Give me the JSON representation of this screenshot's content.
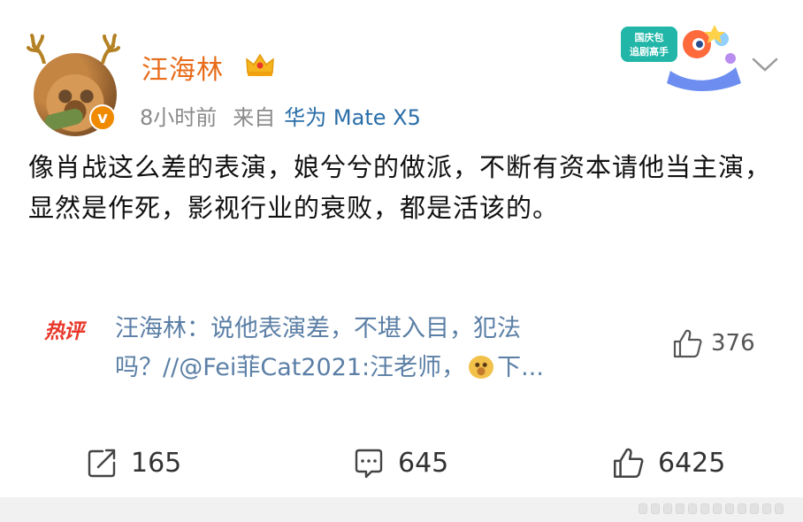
{
  "post": {
    "author": "汪海林",
    "verified_badge": "v",
    "time": "8小时前",
    "source_prefix": "来自",
    "source": "华为 Mate X5",
    "sticker_text": "国庆包\n追剧高手",
    "content": "像肖战这么差的表演，娘兮兮的做派，不断有资本请他当主演，显然是作死，影视行业的衰败，都是活该的。"
  },
  "hot_comment": {
    "tag": "热评",
    "text_before_emoji": "汪海林：说他表演差，不堪入目，犯法吗？//@Fei菲Cat2021:汪老师，",
    "text_after_emoji": "下...",
    "likes": "376"
  },
  "actions": {
    "repost_count": "165",
    "comment_count": "645",
    "like_count": "6425"
  },
  "colors": {
    "author": "#e86c1a",
    "source": "#2a6ea8",
    "hot_tag": "#e8372a",
    "hot_text": "#5b7fa6",
    "vip": "#f08a00"
  },
  "icons": [
    "antler-icon",
    "crown-icon",
    "chevron-down-icon",
    "thumbs-up-icon",
    "repost-icon",
    "comment-icon"
  ]
}
